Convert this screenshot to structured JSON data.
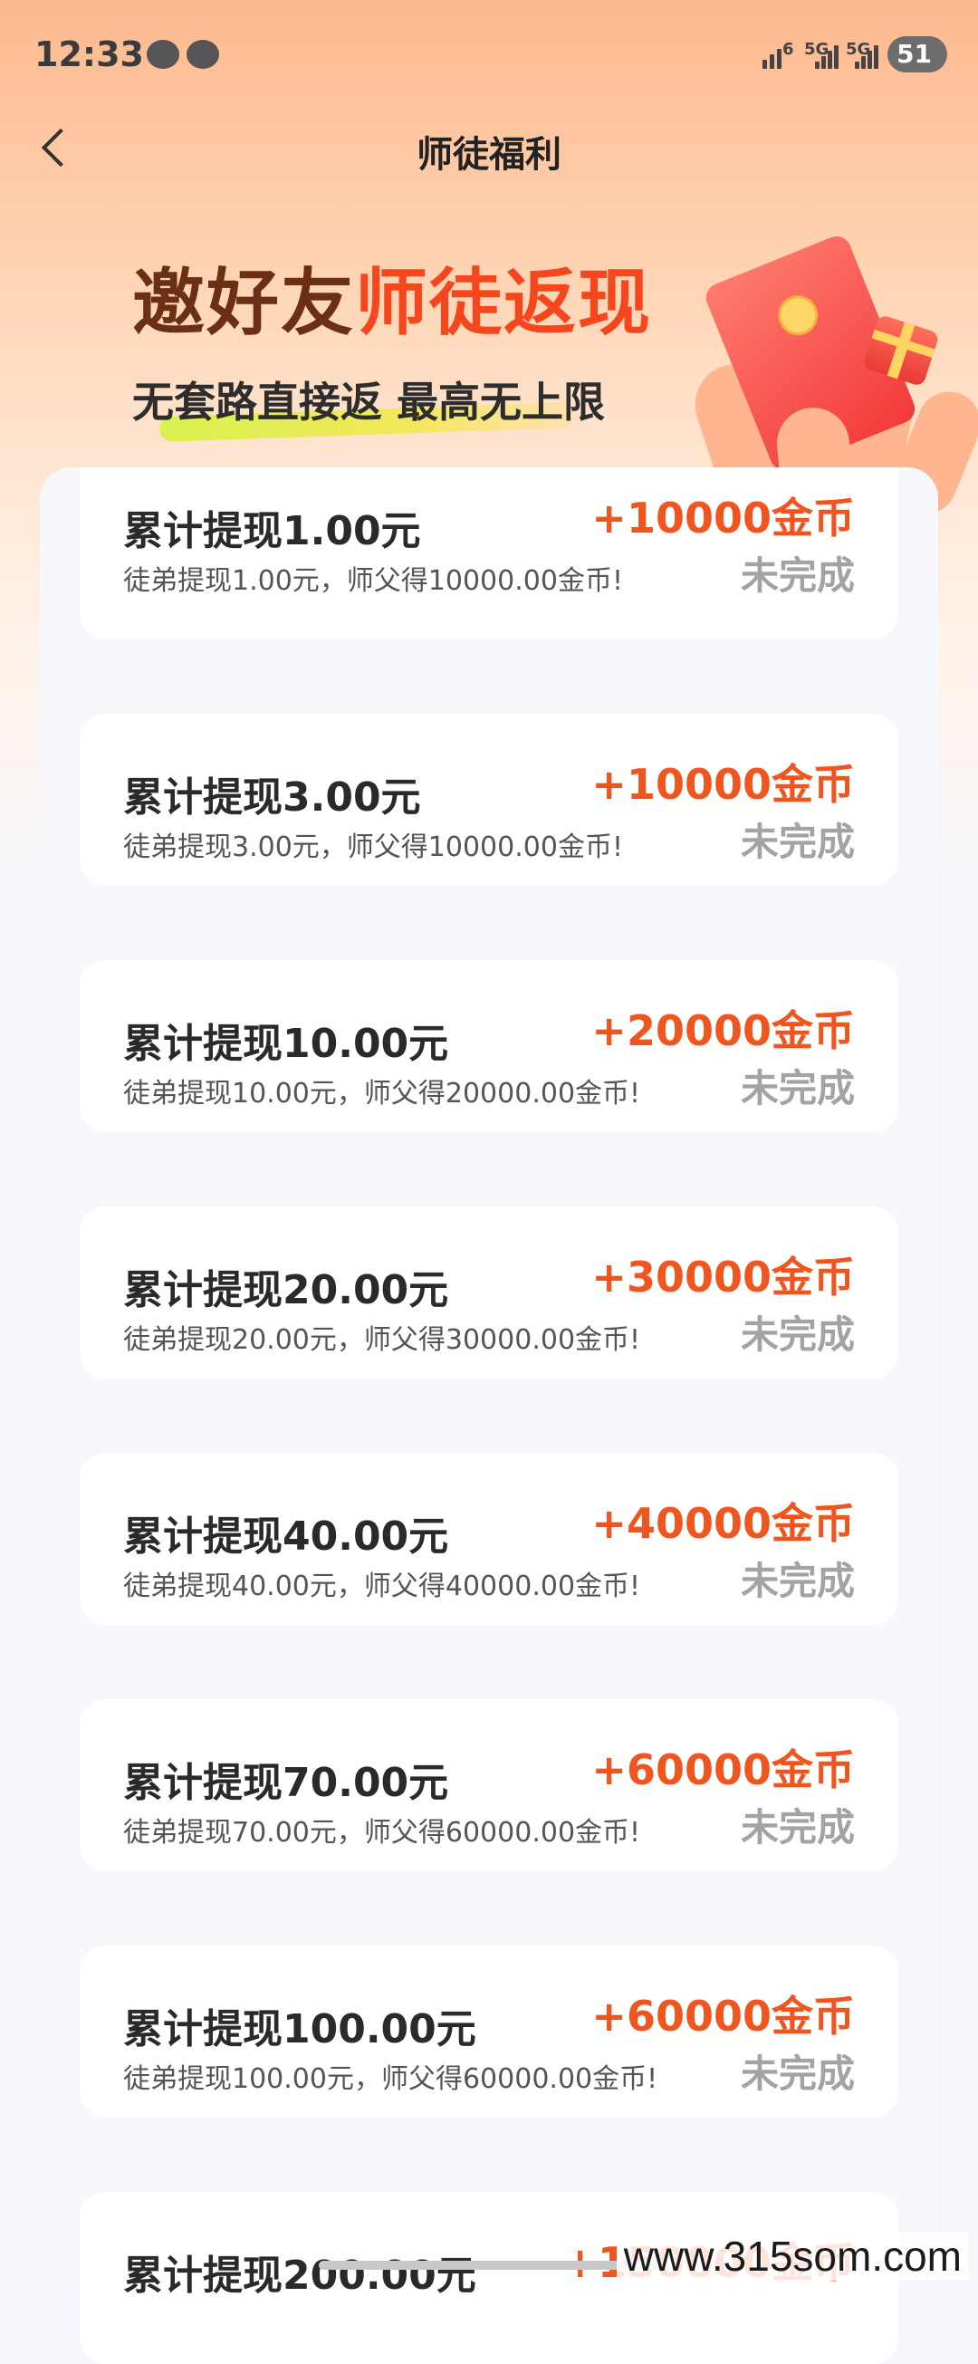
{
  "status_bar": {
    "time": "12:33",
    "signal_labels": [
      "6",
      "5G",
      "5G"
    ],
    "battery": "51"
  },
  "nav": {
    "title": "师徒福利"
  },
  "banner": {
    "title_part1": "邀好友",
    "title_part2": "师徒返现",
    "subtitle": "无套路直接返 最高无上限"
  },
  "cards": [
    {
      "title": "累计提现1.00元",
      "desc": "徒弟提现1.00元，师父得10000.00金币!",
      "reward": "+10000金币",
      "status": "未完成"
    },
    {
      "title": "累计提现3.00元",
      "desc": "徒弟提现3.00元，师父得10000.00金币!",
      "reward": "+10000金币",
      "status": "未完成"
    },
    {
      "title": "累计提现10.00元",
      "desc": "徒弟提现10.00元，师父得20000.00金币!",
      "reward": "+20000金币",
      "status": "未完成"
    },
    {
      "title": "累计提现20.00元",
      "desc": "徒弟提现20.00元，师父得30000.00金币!",
      "reward": "+30000金币",
      "status": "未完成"
    },
    {
      "title": "累计提现40.00元",
      "desc": "徒弟提现40.00元，师父得40000.00金币!",
      "reward": "+40000金币",
      "status": "未完成"
    },
    {
      "title": "累计提现70.00元",
      "desc": "徒弟提现70.00元，师父得60000.00金币!",
      "reward": "+60000金币",
      "status": "未完成"
    },
    {
      "title": "累计提现100.00元",
      "desc": "徒弟提现100.00元，师父得60000.00金币!",
      "reward": "+60000金币",
      "status": "未完成"
    },
    {
      "title": "累计提现200.00元",
      "desc": "",
      "reward": "+150000金币",
      "status": ""
    }
  ],
  "watermark": "www.315som.com",
  "colors": {
    "accent": "#f0541f",
    "title_dark": "#6b2f14",
    "title_highlight": "#f5461e",
    "status_gray": "#a3a3a3"
  }
}
